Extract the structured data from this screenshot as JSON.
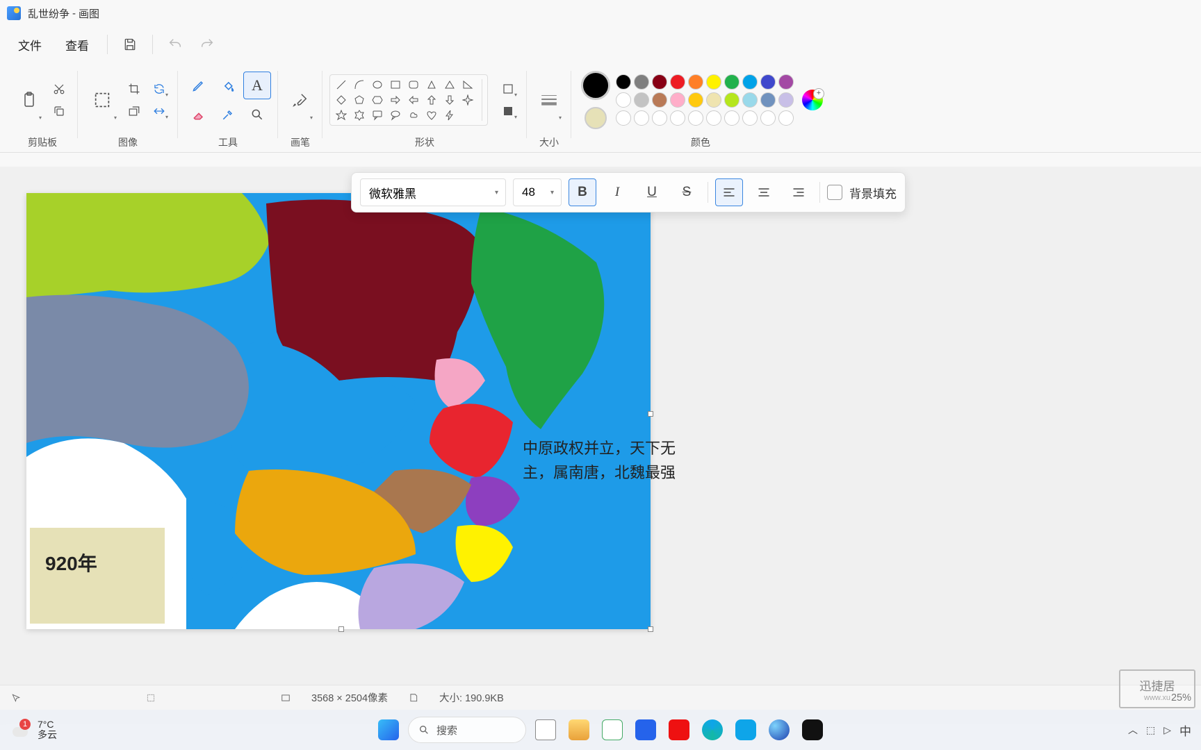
{
  "title": {
    "doc": "乱世纷争",
    "app": "画图"
  },
  "menu": {
    "file": "文件",
    "view": "查看"
  },
  "ribbon": {
    "clipboard": "剪贴板",
    "image": "图像",
    "tools": "工具",
    "brushes": "画笔",
    "shapes": "形状",
    "size": "大小",
    "colors": "颜色"
  },
  "text_toolbar": {
    "font": "微软雅黑",
    "size": "48",
    "bg_fill": "背景填充"
  },
  "canvas": {
    "year_label": "920年",
    "map_text": "中原政权并立，天下无主，属南唐，北魏最强"
  },
  "status": {
    "dims": "3568 × 2504像素",
    "size_label": "大小:",
    "size_value": "190.9KB",
    "zoom": "25%"
  },
  "taskbar": {
    "temp": "7°C",
    "weather": "多云",
    "search": "搜索",
    "ime": "中"
  },
  "swatches": {
    "row1": [
      "#000000",
      "#7f7f7f",
      "#880015",
      "#ed1c24",
      "#ff7f27",
      "#fff200",
      "#22b14c",
      "#00a2e8",
      "#3f48cc",
      "#a349a4"
    ],
    "row2": [
      "#ffffff",
      "#c3c3c3",
      "#b97a57",
      "#ffaec9",
      "#ffc90e",
      "#efe4b0",
      "#b5e61d",
      "#99d9ea",
      "#7092be",
      "#c8bfe7"
    ],
    "row3": [
      "#ffffff",
      "#ffffff",
      "#ffffff",
      "#ffffff",
      "#ffffff",
      "#ffffff",
      "#ffffff",
      "#ffffff",
      "#ffffff",
      "#ffffff"
    ]
  },
  "watermark": {
    "main": "迅捷居",
    "sub": "www.xu"
  }
}
